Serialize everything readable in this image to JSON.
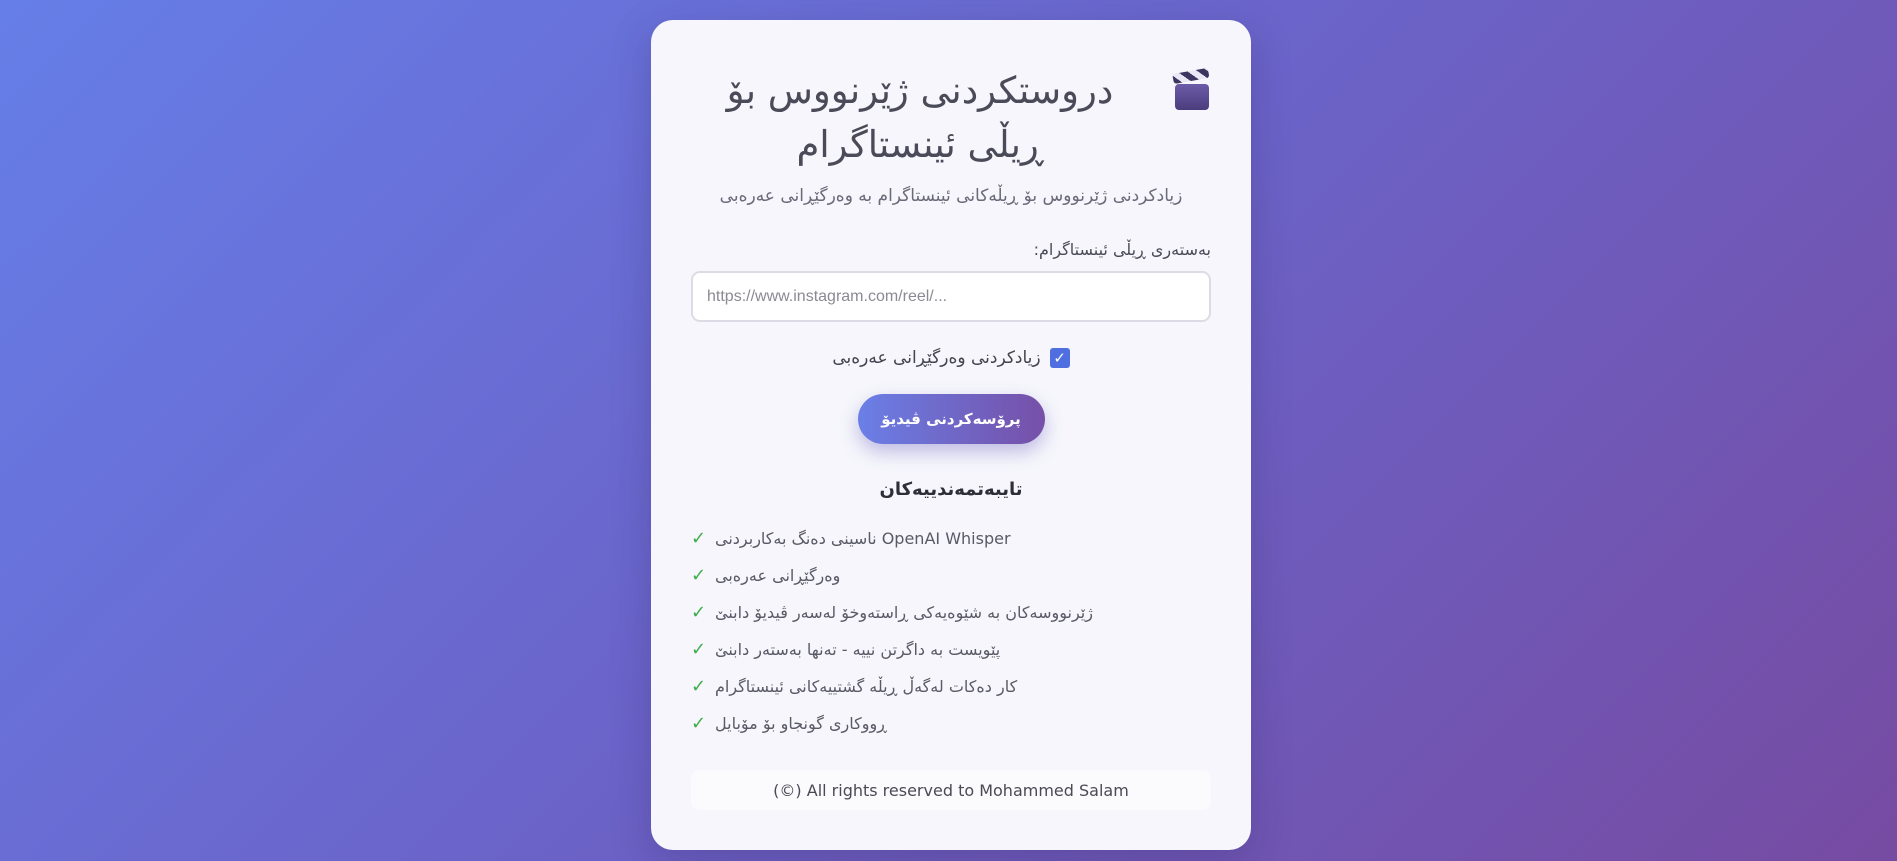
{
  "header": {
    "title": "دروستکردنی ژێرنووس بۆ ڕیڵی ئینستاگرام",
    "title_icon": "clapper-board-icon",
    "subtitle": "زیادکردنی ژێرنووس بۆ ڕیڵەکانی ئینستاگرام بە وەرگێڕانی عەرەبی"
  },
  "form": {
    "url_label": "بەستەری ڕیڵی ئینستاگرام:",
    "url_placeholder": "https://www.instagram.com/reel/...",
    "url_value": "",
    "translate_checkbox_label": "زیادکردنی وەرگێڕانی عەرەبی",
    "translate_checked": true,
    "process_button_label": "پرۆسەکردنی ڤیدیۆ"
  },
  "features": {
    "heading": "تایبەتمەندییەکان",
    "check_symbol": "✓",
    "items": [
      "ناسینی دەنگ بەکاربردنی OpenAI Whisper",
      "وەرگێڕانی عەرەبی",
      "ژێرنووسەکان بە شێوەیەکی ڕاستەوخۆ لەسەر ڤیدیۆ دابنێ",
      "پێویست بە داگرتن نییە - تەنها بەستەر دابنێ",
      "کار دەکات لەگەڵ ڕیڵە گشتییەکانی ئینستاگرام",
      "ڕووکاری گونجاو بۆ مۆبایل"
    ]
  },
  "footer": {
    "text": "(©) All rights reserved to Mohammed Salam"
  },
  "colors": {
    "background_start": "#667ee8",
    "background_end": "#764ba2",
    "accent": "#4f6fe0",
    "check_green": "#3fae4a"
  }
}
